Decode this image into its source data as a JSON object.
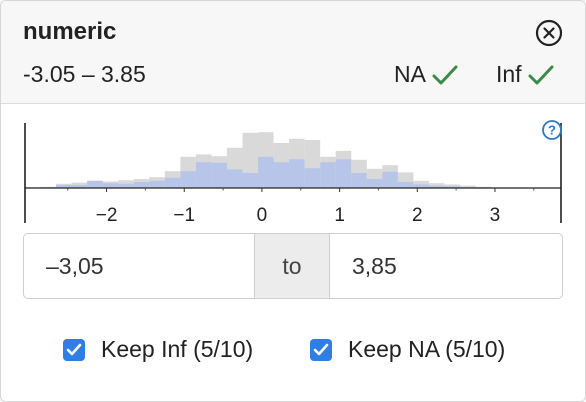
{
  "panel": {
    "title": "numeric",
    "range_text": "-3.05 – 3.85",
    "flags": [
      {
        "label": "NA",
        "icon": "checkmark-icon"
      },
      {
        "label": "Inf",
        "icon": "checkmark-icon"
      }
    ],
    "help_icon": "question-circle-icon",
    "close_icon": "close-circle-icon"
  },
  "filter": {
    "from_value": "–3,05",
    "to_label": "to",
    "to_value": "3,85"
  },
  "checkboxes": [
    {
      "label": "Keep Inf (5/10)",
      "checked": true
    },
    {
      "label": "Keep NA (5/10)",
      "checked": true
    }
  ],
  "colors": {
    "check_green": "#3c8a43",
    "checkbox_blue": "#2f7ee6",
    "hist_gray": "#d9d9d9",
    "hist_blue": "#b7c6e8",
    "help_blue": "#2a78c8"
  },
  "chart_data": {
    "type": "bar",
    "xlim": [
      -3.05,
      3.85
    ],
    "x_ticks": [
      "−2",
      "−1",
      "0",
      "1",
      "2",
      "3"
    ],
    "x_tick_values": [
      -2,
      -1,
      0,
      1,
      2,
      3
    ],
    "bin_width": 0.2,
    "series": [
      {
        "bins": [
          [
            -3.05,
            0.01
          ],
          [
            -2.85,
            0.02
          ],
          [
            -2.65,
            0.07
          ],
          [
            -2.45,
            0.09
          ],
          [
            -2.25,
            0.12
          ],
          [
            -2.05,
            0.11
          ],
          [
            -1.85,
            0.13
          ],
          [
            -1.65,
            0.15
          ],
          [
            -1.45,
            0.18
          ],
          [
            -1.25,
            0.28
          ],
          [
            -1.05,
            0.52
          ],
          [
            -0.85,
            0.56
          ],
          [
            -0.65,
            0.53
          ],
          [
            -0.45,
            0.67
          ],
          [
            -0.25,
            0.92
          ],
          [
            -0.05,
            0.93
          ],
          [
            0.15,
            0.75
          ],
          [
            0.35,
            0.82
          ],
          [
            0.55,
            0.8
          ],
          [
            0.75,
            0.52
          ],
          [
            0.95,
            0.62
          ],
          [
            1.15,
            0.47
          ],
          [
            1.35,
            0.32
          ],
          [
            1.55,
            0.38
          ],
          [
            1.75,
            0.26
          ],
          [
            1.95,
            0.12
          ],
          [
            2.15,
            0.08
          ],
          [
            2.35,
            0.06
          ],
          [
            2.55,
            0.04
          ],
          [
            2.75,
            0.02
          ],
          [
            2.95,
            0.01
          ],
          [
            3.15,
            0.01
          ],
          [
            3.35,
            0.0
          ],
          [
            3.55,
            0.0
          ]
        ]
      },
      {
        "bins": [
          [
            -3.05,
            0.01
          ],
          [
            -2.85,
            0.01
          ],
          [
            -2.65,
            0.05
          ],
          [
            -2.45,
            0.05
          ],
          [
            -2.25,
            0.12
          ],
          [
            -2.05,
            0.08
          ],
          [
            -1.85,
            0.07
          ],
          [
            -1.65,
            0.1
          ],
          [
            -1.45,
            0.12
          ],
          [
            -1.25,
            0.17
          ],
          [
            -1.05,
            0.28
          ],
          [
            -0.85,
            0.43
          ],
          [
            -0.65,
            0.42
          ],
          [
            -0.45,
            0.31
          ],
          [
            -0.25,
            0.25
          ],
          [
            -0.05,
            0.52
          ],
          [
            0.15,
            0.43
          ],
          [
            0.35,
            0.48
          ],
          [
            0.55,
            0.33
          ],
          [
            0.75,
            0.43
          ],
          [
            0.95,
            0.48
          ],
          [
            1.15,
            0.25
          ],
          [
            1.35,
            0.15
          ],
          [
            1.55,
            0.27
          ],
          [
            1.75,
            0.1
          ],
          [
            1.95,
            0.06
          ],
          [
            2.15,
            0.04
          ],
          [
            2.35,
            0.03
          ],
          [
            2.55,
            0.01
          ],
          [
            2.75,
            0.01
          ],
          [
            2.95,
            0.0
          ],
          [
            3.15,
            0.0
          ],
          [
            3.35,
            0.0
          ],
          [
            3.55,
            0.0
          ]
        ]
      }
    ]
  }
}
